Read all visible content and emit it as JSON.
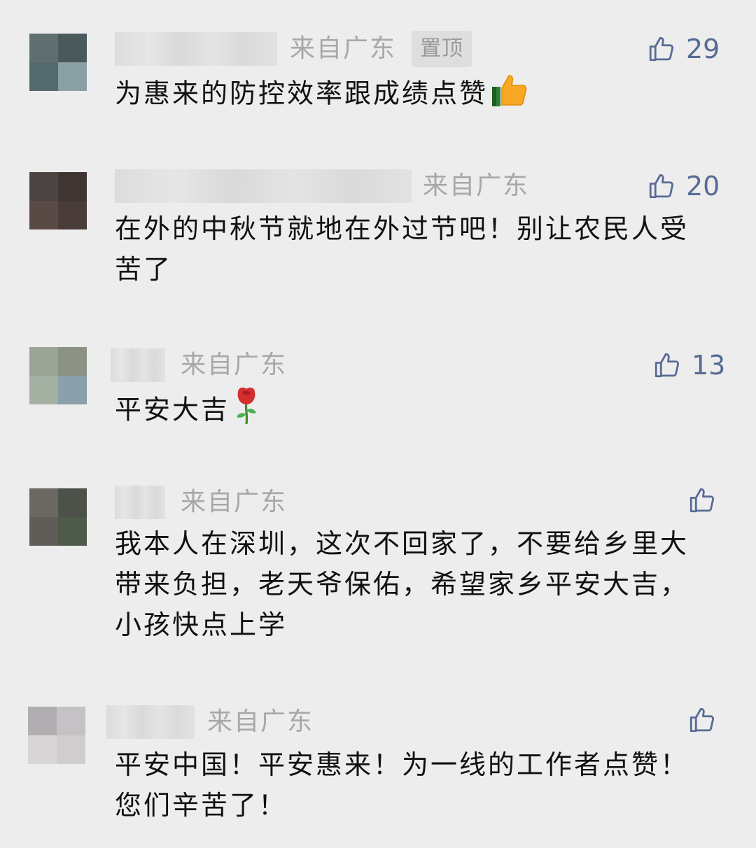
{
  "comments": [
    {
      "location": "来自广东",
      "pinned_label": "置顶",
      "likes": "29",
      "text": "为惠来的防控效率跟成绩点赞",
      "emoji": "thumbs-up-emoji",
      "avatar_colors": [
        "#5f6f6f",
        "#4a5a5a",
        "#54696b",
        "#8aa0a4"
      ]
    },
    {
      "location": "来自广东",
      "likes": "20",
      "text": "在外的中秋节就地在外过节吧！别让农民人受苦了",
      "avatar_colors": [
        "#4c4442",
        "#3f3533",
        "#5a4a45",
        "#4a3c38"
      ]
    },
    {
      "location": "来自广东",
      "likes": "13",
      "text": "平安大吉",
      "emoji": "rose-emoji",
      "avatar_colors": [
        "#9aa596",
        "#8c9384",
        "#a3b0a2",
        "#8aa0aa"
      ]
    },
    {
      "location": "来自广东",
      "likes": "",
      "text": "我本人在深圳，这次不回家了，不要给乡里大带来负担，老天爷保佑，希望家乡平安大吉，小孩快点上学",
      "avatar_colors": [
        "#6b6762",
        "#4d5149",
        "#605c57",
        "#4e5a4a"
      ]
    },
    {
      "location": "来自广东",
      "likes": "",
      "text": "平安中国！平安惠来！为一线的工作者点赞！您们辛苦了！",
      "avatar_colors": [
        "#b0aeb0",
        "#c4c2c4",
        "#d8d6d6",
        "#cfcdcd"
      ]
    }
  ],
  "colors": {
    "background": "#ededed",
    "location": "#a8a8a8",
    "like_icon": "#576b95",
    "text": "#111111"
  }
}
